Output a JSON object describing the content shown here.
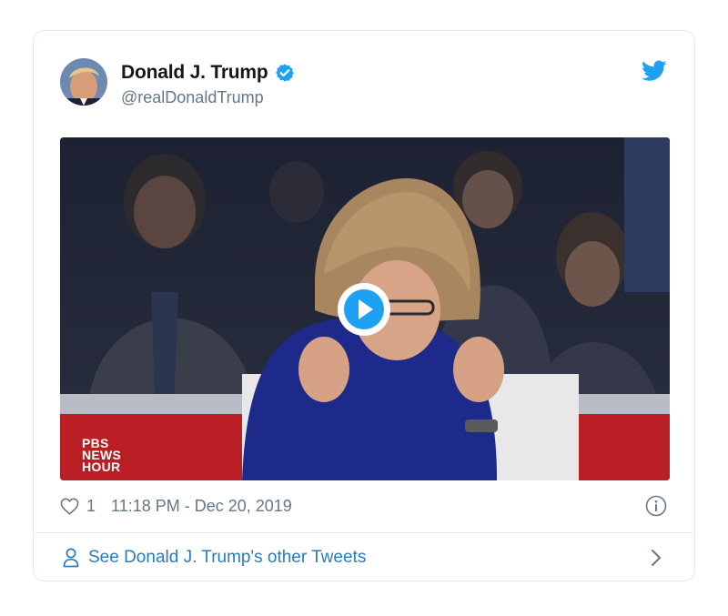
{
  "tweet": {
    "display_name": "Donald J. Trump",
    "handle": "@realDonaldTrump",
    "like_count": "1",
    "timestamp": "11:18 PM - Dec 20, 2019"
  },
  "media": {
    "logo_lines": [
      "PBS",
      "NEWS",
      "HOUR"
    ]
  },
  "footer": {
    "link_text": "See Donald J. Trump's other Tweets"
  },
  "icons": {
    "verified": "verified-badge-icon",
    "bird": "twitter-bird-icon",
    "play": "play-icon",
    "heart": "heart-icon",
    "info": "info-icon",
    "person": "person-icon",
    "chevron": "chevron-right-icon"
  },
  "colors": {
    "brand_blue": "#1da1f2",
    "link_blue": "#2b7bb9",
    "muted_text": "#657786",
    "border": "#e1e8ed"
  }
}
